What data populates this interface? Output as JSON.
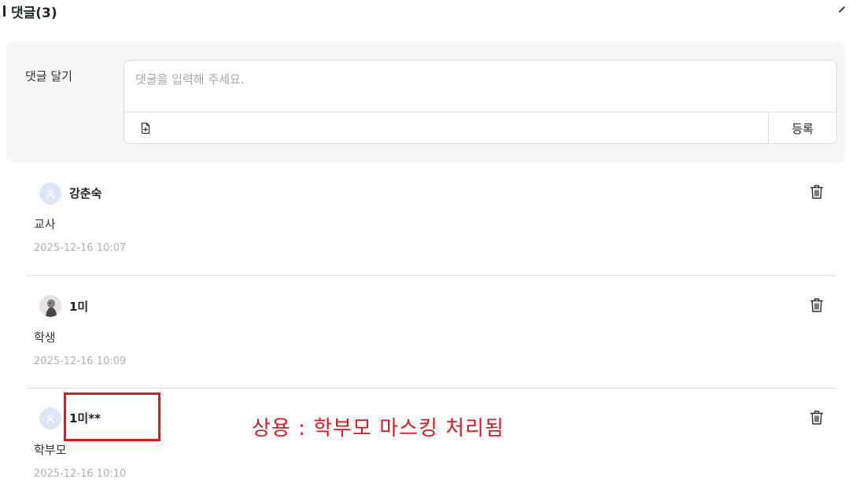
{
  "header": {
    "title": "댓글(3)"
  },
  "composer": {
    "label": "댓글 달기",
    "placeholder": "댓글을 입력해 주세요.",
    "submit_label": "등록"
  },
  "comments": [
    {
      "author": "강춘숙",
      "body": "교사",
      "date": "2025-12-16 10:07",
      "avatar": "default-user-icon"
    },
    {
      "author": "1미",
      "body": "학생",
      "date": "2025-12-16 10:09",
      "avatar": "photo"
    },
    {
      "author": "1미**",
      "body": "학부모",
      "date": "2025-12-16 10:10",
      "avatar": "default-user-icon"
    }
  ],
  "annotation": {
    "text": "상용 : 학부모 마스킹 처리됨",
    "color": "#e0181e"
  },
  "colors": {
    "panel_bg": "#f6f6f6",
    "avatar_bg": "#dde6f7",
    "date_text": "#b0b0b0"
  }
}
